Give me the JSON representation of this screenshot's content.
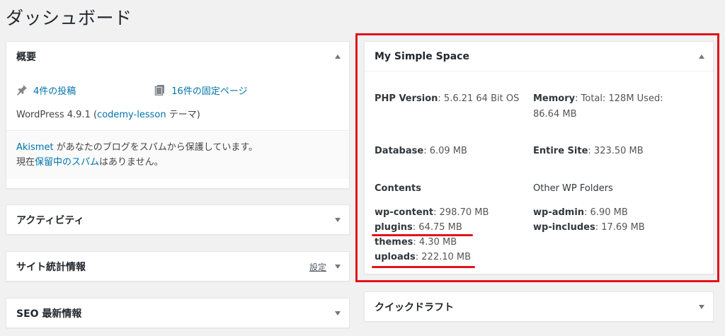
{
  "page": {
    "title": "ダッシュボード"
  },
  "overview": {
    "title": "概要",
    "posts": "4件の投稿",
    "pages": "16件の固定ページ",
    "version_prefix": "WordPress 4.9.1 (",
    "theme_link": "codemy-lesson",
    "version_suffix": " テーマ)",
    "akismet_link": "Akismet",
    "akismet_text": " があなたのブログをスパムから保護しています。",
    "pending_prefix": "現在",
    "pending_link": "保留中のスパム",
    "pending_suffix": "はありません。"
  },
  "activity": {
    "title": "アクティビティ"
  },
  "site_stats": {
    "title": "サイト統計情報",
    "settings_link": "設定"
  },
  "seo_news": {
    "title": "SEO 最新情報"
  },
  "quick_draft": {
    "title": "クイックドラフト"
  },
  "simple_space": {
    "title": "My Simple Space",
    "php_label": "PHP Version",
    "php_value": ": 5.6.21 64 Bit OS",
    "memory_label": "Memory",
    "memory_value": ": Total: 128M Used:",
    "memory_value2": "86.64 MB",
    "database_label": "Database",
    "database_value": ": 6.09 MB",
    "entire_label": "Entire Site",
    "entire_value": ": 323.50 MB",
    "contents_title": "Contents",
    "other_title": "Other WP Folders",
    "wp_content_label": "wp-content",
    "wp_content_value": ": 298.70 MB",
    "plugins_label": "plugins",
    "plugins_value": ": 64.75 MB",
    "themes_label": "themes",
    "themes_value": ": 4.30 MB",
    "uploads_label": "uploads",
    "uploads_value": ": 222.10 MB",
    "wp_admin_label": "wp-admin",
    "wp_admin_value": ": 6.90 MB",
    "wp_includes_label": "wp-includes",
    "wp_includes_value": ": 17.69 MB"
  },
  "colors": {
    "highlight": "#e0141e",
    "link": "#0073aa",
    "background": "#f1f1f1"
  }
}
